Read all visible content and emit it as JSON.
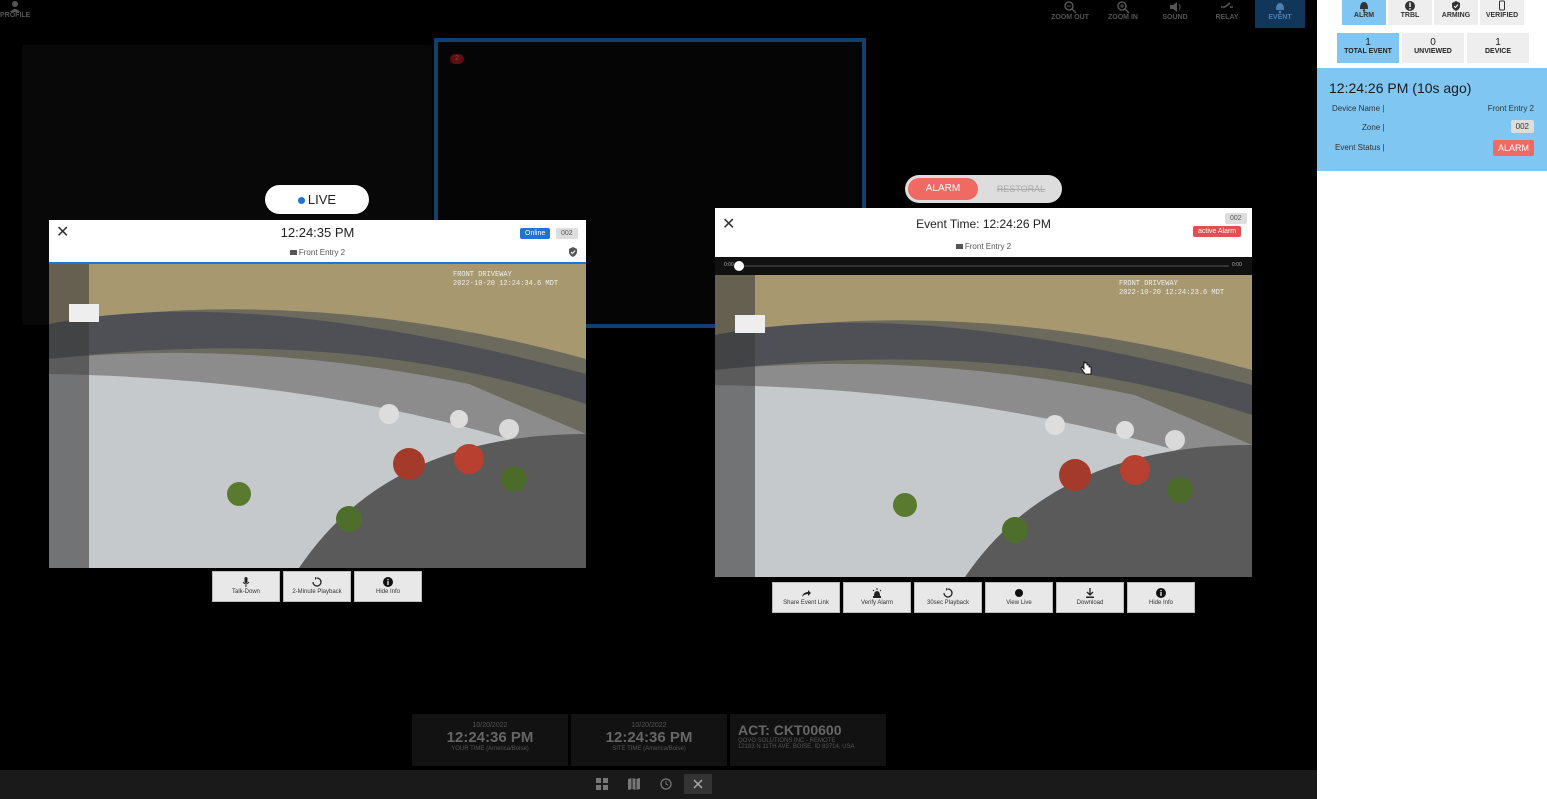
{
  "toolbar": {
    "profile_label": "PROFILE",
    "buttons": [
      {
        "label": "ZOOM OUT",
        "icon": "zoom-out-icon"
      },
      {
        "label": "ZOOM IN",
        "icon": "zoom-in-icon"
      },
      {
        "label": "SOUND",
        "icon": "sound-icon"
      },
      {
        "label": "RELAY",
        "icon": "relay-icon"
      },
      {
        "label": "EVENT",
        "icon": "bell-icon"
      }
    ],
    "marker_number": "2"
  },
  "live_viewer": {
    "live_label": "LIVE",
    "time": "12:24:35 PM",
    "status_badge": "Online",
    "zone": "002",
    "device": "Front Entry 2",
    "overlay_line1": "FRONT DRIVEWAY",
    "overlay_line2": "2022-10-20 12:24:34.6 MDT",
    "controls": [
      {
        "label": "Talk-Down",
        "icon": "microphone-icon"
      },
      {
        "label": "2-Minute Playback",
        "icon": "replay-icon"
      },
      {
        "label": "Hide Info",
        "icon": "info-icon"
      }
    ]
  },
  "event_viewer": {
    "toggle_alarm": "ALARM",
    "toggle_restoral": "RESTORAL",
    "title": "Event Time: 12:24:26 PM",
    "zone": "002",
    "status_badge": "active Alarm",
    "device": "Front Entry 2",
    "progress_start": "0:00",
    "progress_end": "0:00",
    "progress_fraction": 0.0,
    "overlay_line1": "FRONT DRIVEWAY",
    "overlay_line2": "2022-10-20 12:24:23.6 MDT",
    "controls": [
      {
        "label": "Share Event Link",
        "icon": "share-icon"
      },
      {
        "label": "Verify Alarm",
        "icon": "siren-icon"
      },
      {
        "label": "30sec Playback",
        "icon": "replay-icon"
      },
      {
        "label": "View Live",
        "icon": "record-dot-icon"
      },
      {
        "label": "Download",
        "icon": "download-icon"
      },
      {
        "label": "Hide Info",
        "icon": "info-icon"
      }
    ]
  },
  "sidebar": {
    "tabs": [
      {
        "label": "ALRM",
        "icon": "bell-icon",
        "active": true
      },
      {
        "label": "TRBL",
        "icon": "alert-icon",
        "active": false
      },
      {
        "label": "ARMING",
        "icon": "shield-check-icon",
        "active": false
      },
      {
        "label": "VERIFIED",
        "icon": "phone-icon",
        "active": false
      }
    ],
    "counts": [
      {
        "value": "1",
        "label": "TOTAL EVENT",
        "active": true
      },
      {
        "value": "0",
        "label": "UNVIEWED",
        "active": false
      },
      {
        "value": "1",
        "label": "DEVICE",
        "active": false
      }
    ],
    "event_card": {
      "time": "12:24:26 PM (10s ago)",
      "device_name_label": "Device Name |",
      "device_name": "Front Entry 2",
      "zone_label": "Zone |",
      "zone": "002",
      "status_label": "Event Status |",
      "status": "ALARM"
    }
  },
  "bottom": {
    "your_time": {
      "date": "10/20/2022",
      "time": "12:24:36 PM",
      "label": "YOUR TIME (America/Boise)"
    },
    "site_time": {
      "date": "10/20/2022",
      "time": "12:24:36 PM",
      "label": "SITE TIME (America/Boise)"
    },
    "account": {
      "title": "ACT: CKT00600",
      "line1": "QOVO SOLUTIONS INC - REMOTE",
      "line2": "12183 N 11TH AVE, BOISE, ID 83714, USA"
    },
    "bar_buttons": [
      {
        "icon": "grid-icon"
      },
      {
        "icon": "map-icon"
      },
      {
        "icon": "history-icon"
      },
      {
        "icon": "close-icon"
      }
    ]
  },
  "colors": {
    "accent_blue": "#1f73d6",
    "alarm_red": "#f06a63",
    "sidebar_active": "#7fc7f2",
    "frame_blue": "#12406e"
  }
}
